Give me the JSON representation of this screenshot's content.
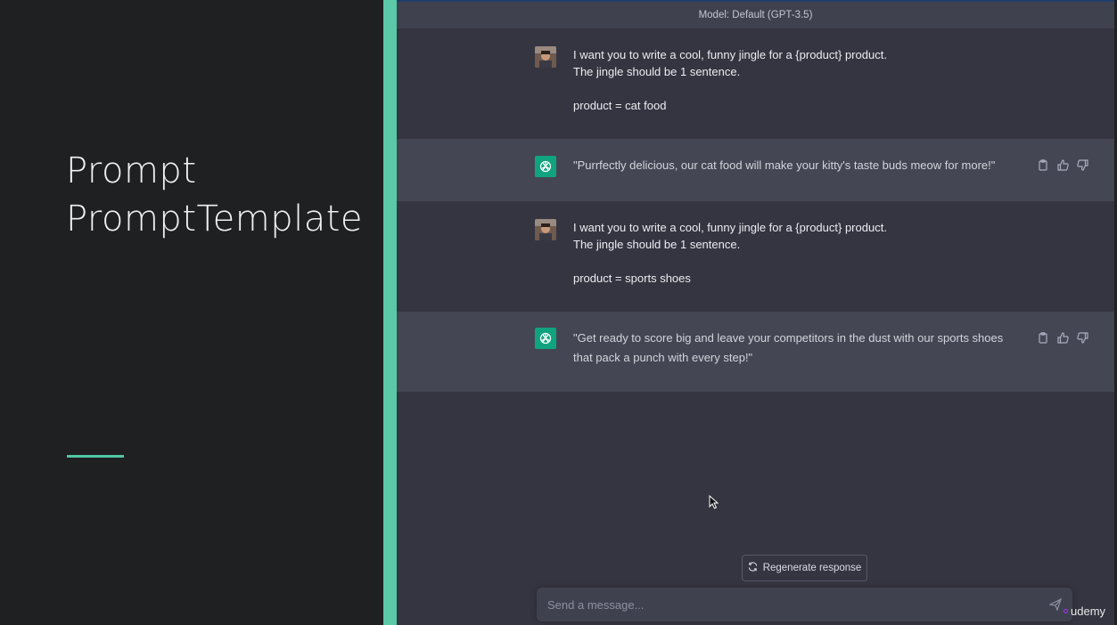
{
  "slide": {
    "title_line1": "Prompt",
    "title_line2": "PromptTemplate",
    "accent_color": "#5bc8a8"
  },
  "chat": {
    "model_label": "Model: Default (GPT-3.5)",
    "messages": [
      {
        "role": "user",
        "lines": [
          "I want you to write a cool, funny jingle for a {product} product.",
          "The jingle should be 1 sentence.",
          "",
          "product = cat food"
        ]
      },
      {
        "role": "assistant",
        "text": "\"Purrfectly delicious, our cat food will make your kitty's taste buds meow for more!\""
      },
      {
        "role": "user",
        "lines": [
          "I want you to write a cool, funny jingle for a {product} product.",
          "The jingle should be 1 sentence.",
          "",
          "product = sports shoes"
        ]
      },
      {
        "role": "assistant",
        "text": "\"Get ready to score big and leave your competitors in the dust with our sports shoes that pack a punch with every step!\""
      }
    ],
    "regenerate_label": "Regenerate response",
    "composer_placeholder": "Send a message...",
    "icons": [
      "user-avatar",
      "openai-logo-icon",
      "copy-icon",
      "thumbs-up-icon",
      "thumbs-down-icon",
      "refresh-icon",
      "send-icon",
      "mouse-cursor"
    ]
  },
  "watermark": {
    "text": "udemy",
    "brand_color": "#a435f0"
  }
}
